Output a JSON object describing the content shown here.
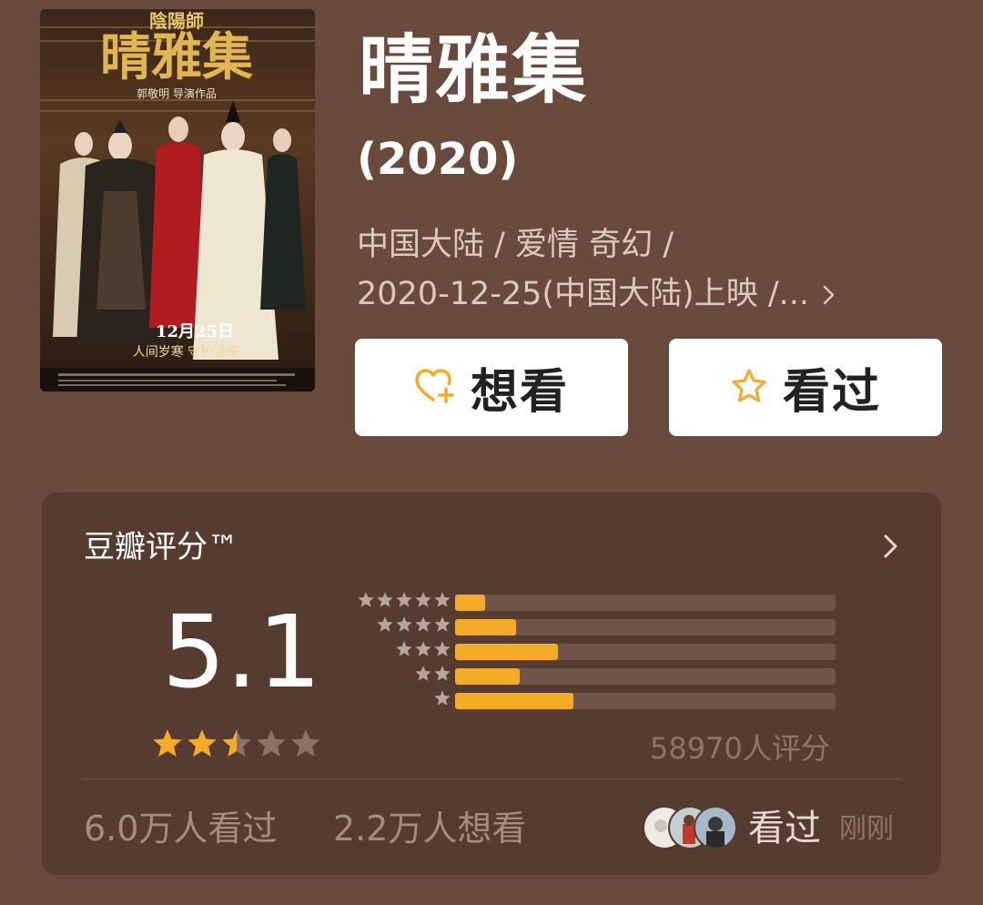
{
  "movie": {
    "title": "晴雅集",
    "year": "(2020)",
    "meta_line1": "中国大陆 / 爱情 奇幻 /",
    "meta_line2": "2020-12-25(中国大陆)上映 /...",
    "poster": {
      "series": "陰陽師",
      "title": "晴雅集",
      "director": "郭敬明 导演作品",
      "date": "12月25日",
      "tagline": "人间岁寒 守护温暖"
    }
  },
  "buttons": {
    "want": {
      "label": "想看",
      "icon": "heart-plus-icon",
      "icon_color": "#f5ab28"
    },
    "seen": {
      "label": "看过",
      "icon": "star-outline-icon",
      "icon_color": "#f5ab28"
    }
  },
  "rating": {
    "title": "豆瓣评分™",
    "score": "5.1",
    "stars_value": 2.5,
    "stars_max": 5,
    "distribution": [
      {
        "stars": 5,
        "percent": 8
      },
      {
        "stars": 4,
        "percent": 16
      },
      {
        "stars": 3,
        "percent": 27
      },
      {
        "stars": 2,
        "percent": 17
      },
      {
        "stars": 1,
        "percent": 31
      }
    ],
    "count_text": "58970人评分",
    "watched_text": "6.0万人看过",
    "wish_text": "2.2万人想看",
    "friend_action": "看过",
    "friend_time": "刚刚"
  },
  "colors": {
    "background": "#6a4a3c",
    "card": "#563b31",
    "accent": "#f5ab28",
    "star_empty": "#8a7268"
  }
}
